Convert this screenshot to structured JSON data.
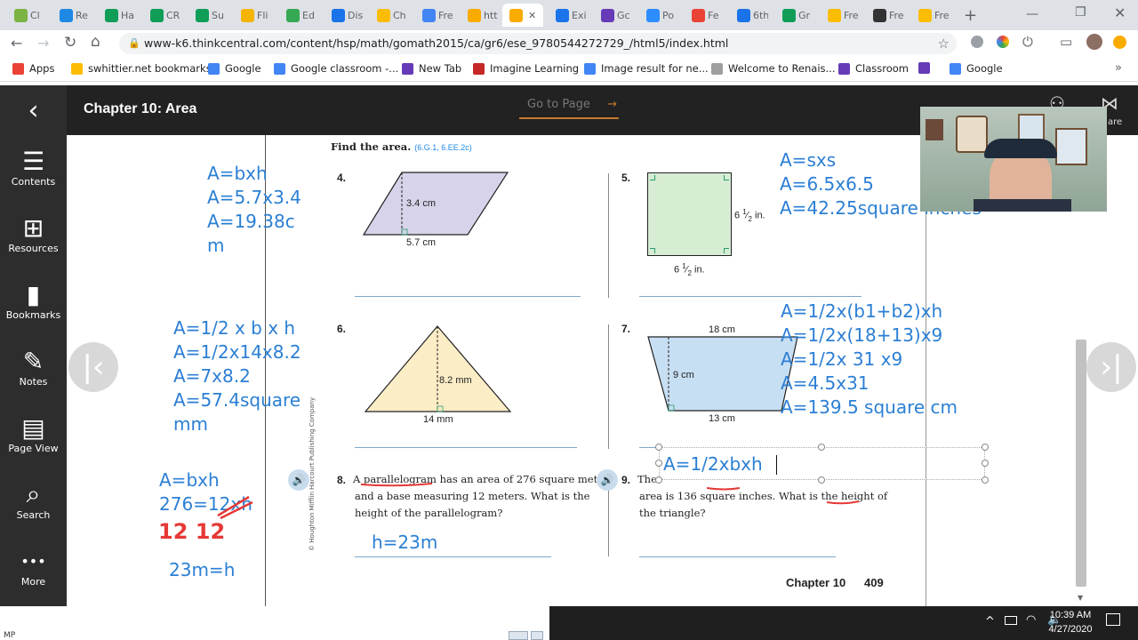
{
  "browser": {
    "tabs": [
      {
        "label": "Cl",
        "color": "#7cb342"
      },
      {
        "label": "Re",
        "color": "#1e88e5"
      },
      {
        "label": "Ha",
        "color": "#0f9d58"
      },
      {
        "label": "CR",
        "color": "#0f9d58"
      },
      {
        "label": "Su",
        "color": "#0f9d58"
      },
      {
        "label": "Fli",
        "color": "#f4b400"
      },
      {
        "label": "Ed",
        "color": "#34a853"
      },
      {
        "label": "Dis",
        "color": "#1a73e8"
      },
      {
        "label": "Ch",
        "color": "#fbbc04"
      },
      {
        "label": "Fre",
        "color": "#4285f4"
      },
      {
        "label": "htt",
        "color": "#f9ab00"
      },
      {
        "label": "",
        "color": "#f9ab00"
      },
      {
        "label": "Exi",
        "color": "#1a73e8"
      },
      {
        "label": "Gc",
        "color": "#673ab7"
      },
      {
        "label": "Po",
        "color": "#2d8cff"
      },
      {
        "label": "Fe",
        "color": "#ea4335"
      },
      {
        "label": "6th",
        "color": "#1a73e8"
      },
      {
        "label": "Gr",
        "color": "#0f9d58"
      },
      {
        "label": "Fre",
        "color": "#fbbc04"
      },
      {
        "label": "Fre",
        "color": "#333333"
      },
      {
        "label": "Fre",
        "color": "#fbbc04"
      }
    ],
    "url": "www-k6.thinkcentral.com/content/hsp/math/gomath2015/ca/gr6/ese_9780544272729_/html5/index.html",
    "bookmarks": [
      {
        "label": "Apps",
        "color": "#ea4335"
      },
      {
        "label": "swhittier.net bookmarks",
        "color": "#fbbc04"
      },
      {
        "label": "Google",
        "color": "#4285f4"
      },
      {
        "label": "Google classroom -...",
        "color": "#4285f4"
      },
      {
        "label": "New Tab",
        "color": "#673ab7"
      },
      {
        "label": "Imagine Learning",
        "color": "#c62828"
      },
      {
        "label": "Image result for ne...",
        "color": "#4285f4"
      },
      {
        "label": "Welcome to Renais...",
        "color": "#9e9e9e"
      },
      {
        "label": "Classroom",
        "color": "#673ab7"
      },
      {
        "label": "",
        "color": "#673ab7"
      },
      {
        "label": "Google",
        "color": "#4285f4"
      }
    ]
  },
  "app": {
    "title": "Chapter 10: Area",
    "goto_page": "Go to Page",
    "goto_arrow": "→",
    "share_label": "are"
  },
  "rail": [
    {
      "label": "Contents",
      "icon": "list-icon"
    },
    {
      "label": "Resources",
      "icon": "folder-plus-icon"
    },
    {
      "label": "Bookmarks",
      "icon": "bookmark-icon"
    },
    {
      "label": "Notes",
      "icon": "pencil-icon"
    },
    {
      "label": "Page View",
      "icon": "page-view-icon"
    },
    {
      "label": "Search",
      "icon": "search-icon"
    },
    {
      "label": "More",
      "icon": "more-icon"
    }
  ],
  "page": {
    "header": "Find the area.",
    "standards": "(6.G.1, 6.EE.2c)",
    "p4": {
      "num": "4.",
      "height": "3.4 cm",
      "base": "5.7 cm"
    },
    "p5": {
      "num": "5.",
      "side": "6",
      "fr_n": "1",
      "fr_d": "2",
      "unit": "in."
    },
    "p6": {
      "num": "6.",
      "height": "8.2 mm",
      "base": "14 mm"
    },
    "p7": {
      "num": "7.",
      "top": "18 cm",
      "height": "9 cm",
      "bottom": "13 cm"
    },
    "p8": {
      "num": "8.",
      "text1": "A parallelogram has an area of 276 square meters",
      "text2": "and a base measuring 12 meters. What is the",
      "text3": "height of the parallelogram?"
    },
    "p9": {
      "num": "9.",
      "text1": "The",
      "text2": "area is 136 square inches. What is the height of",
      "text3": "the triangle?"
    },
    "footer_chapter": "Chapter 10",
    "footer_page": "409",
    "copyright": "© Houghton Mifflin Harcourt Publishing Company"
  },
  "annotations": {
    "a4": [
      "A=bxh",
      "A=5.7x3.4",
      "A=19.38c",
      "m"
    ],
    "a5": [
      "A=sxs",
      "A=6.5x6.5",
      "A=42.25square inches"
    ],
    "a6": [
      "A=1/2 x b x h",
      "A=1/2x14x8.2",
      "A=7x8.2",
      "A=57.4square",
      "mm"
    ],
    "a7": [
      "A=1/2x(b1+b2)xh",
      "A=1/2x(18+13)x9",
      "A=1/2x 31 x9",
      "A=4.5x31",
      "A=139.5 square cm"
    ],
    "a8": [
      "A=bxh",
      "276=12xh",
      "12   12",
      "23m=h"
    ],
    "a8_answer": "h=23m",
    "a9": "A=1/2xbxh"
  },
  "taskbar": {
    "time": "10:39 AM",
    "date": "4/27/2020"
  },
  "bottom_left_text": "MP"
}
